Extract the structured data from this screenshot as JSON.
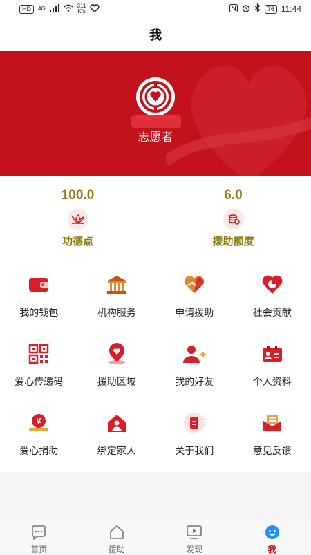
{
  "status_bar": {
    "hd": "HD",
    "net": "4G",
    "speed": "311",
    "speed_unit": "K/s",
    "battery": "76",
    "time": "11:44"
  },
  "header": {
    "title": "我"
  },
  "profile": {
    "role": "志愿者"
  },
  "stats": [
    {
      "value": "100.0",
      "label": "功德点",
      "icon": "lotus-icon"
    },
    {
      "value": "6.0",
      "label": "援助额度",
      "icon": "coins-icon"
    }
  ],
  "menu": [
    {
      "label": "我的钱包",
      "icon": "wallet-icon"
    },
    {
      "label": "机构服务",
      "icon": "institution-icon"
    },
    {
      "label": "申请援助",
      "icon": "handshake-heart-icon"
    },
    {
      "label": "社会贡献",
      "icon": "heart-pie-icon"
    },
    {
      "label": "爱心传递码",
      "icon": "qrcode-icon"
    },
    {
      "label": "援助区域",
      "icon": "location-heart-icon"
    },
    {
      "label": "我的好友",
      "icon": "add-friend-icon"
    },
    {
      "label": "个人资料",
      "icon": "id-card-icon"
    },
    {
      "label": "爱心捐助",
      "icon": "yuan-donation-icon"
    },
    {
      "label": "绑定家人",
      "icon": "home-person-icon"
    },
    {
      "label": "关于我们",
      "icon": "info-doc-icon"
    },
    {
      "label": "意见反馈",
      "icon": "feedback-envelope-icon"
    }
  ],
  "tabs": [
    {
      "label": "首页",
      "icon": "chat-icon",
      "active": false
    },
    {
      "label": "援助",
      "icon": "home-icon",
      "active": false
    },
    {
      "label": "发现",
      "icon": "video-icon",
      "active": false
    },
    {
      "label": "我",
      "icon": "smile-icon",
      "active": true
    }
  ],
  "colors": {
    "brand_red": "#c4121d",
    "gold": "#8c7a12",
    "active_blue": "#1e90ff"
  }
}
